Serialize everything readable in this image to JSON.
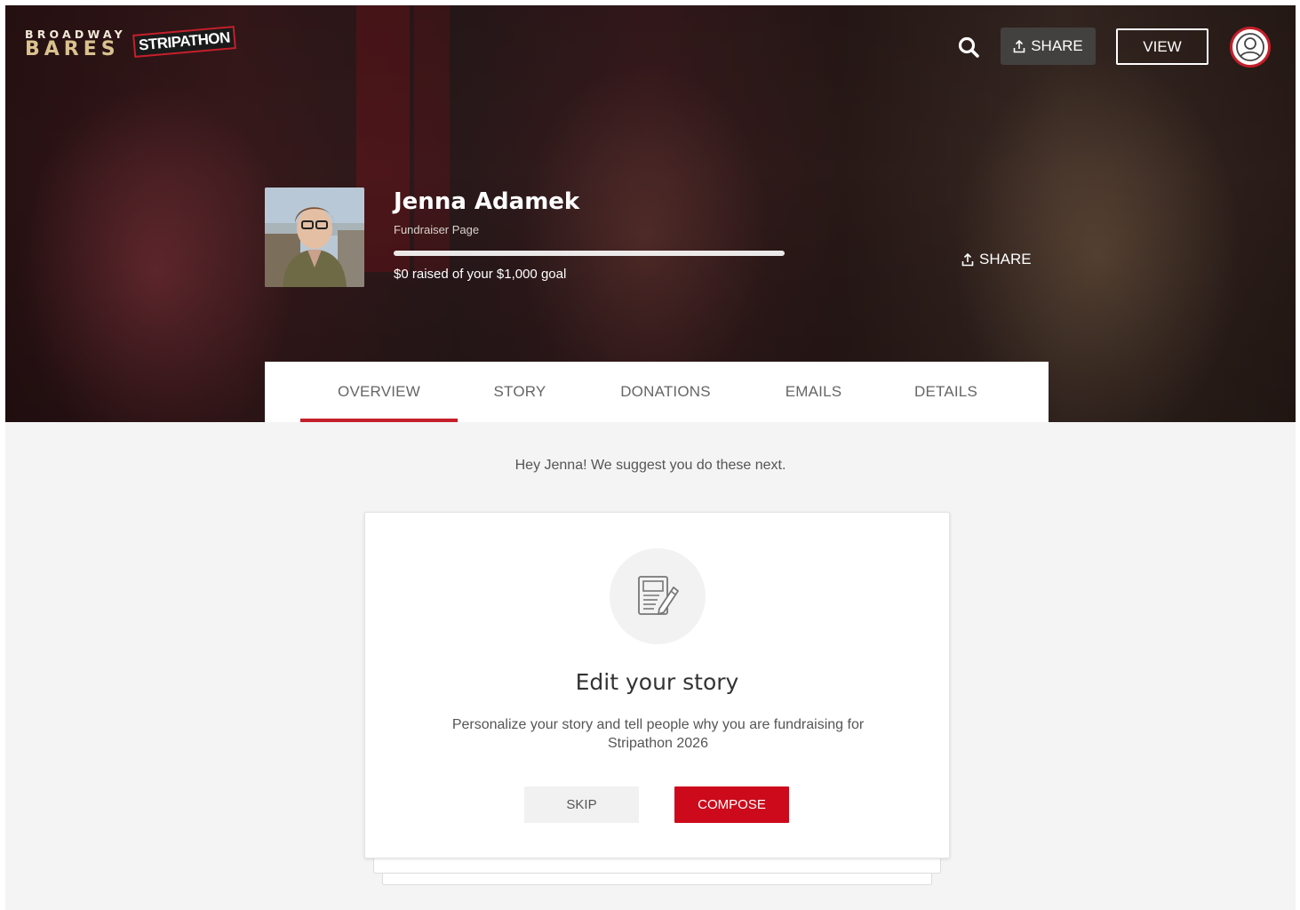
{
  "header": {
    "logo": {
      "top_text": "BROADWAY",
      "bottom_text": "BARES",
      "badge_text": "STRIPATHON"
    },
    "actions": {
      "share_label": "SHARE",
      "view_label": "VIEW"
    }
  },
  "profile": {
    "name": "Jenna Adamek",
    "subtitle": "Fundraiser Page",
    "progress_text": "$0 raised of your $1,000 goal",
    "progress_fraction": 0.0,
    "share_label": "SHARE"
  },
  "tabs": [
    {
      "label": "OVERVIEW",
      "active": true
    },
    {
      "label": "STORY",
      "active": false
    },
    {
      "label": "DONATIONS",
      "active": false
    },
    {
      "label": "EMAILS",
      "active": false
    },
    {
      "label": "DETAILS",
      "active": false
    }
  ],
  "suggestion": {
    "intro": "Hey Jenna! We suggest you do these next.",
    "card": {
      "title": "Edit your story",
      "description": "Personalize your story and tell people why you are fundraising for Stripathon 2026",
      "skip_label": "SKIP",
      "compose_label": "COMPOSE"
    }
  },
  "colors": {
    "accent": "#c41f2a",
    "button_red": "#cc0a1b",
    "background": "#f4f4f4"
  }
}
